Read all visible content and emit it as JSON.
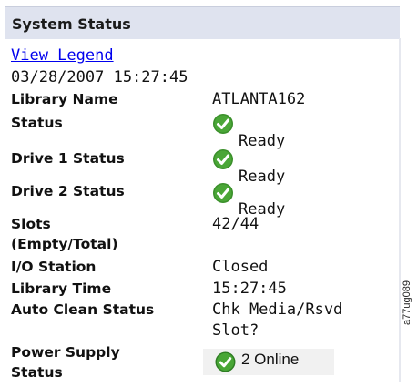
{
  "panel": {
    "title": "System Status",
    "legend_link": "View Legend",
    "timestamp": "03/28/2007 15:27:45"
  },
  "rows": {
    "library_name": {
      "label": "Library Name",
      "value": "ATLANTA162"
    },
    "status": {
      "label": "Status",
      "icon": "ready-check-icon",
      "value": "Ready"
    },
    "drive1": {
      "label": "Drive 1 Status",
      "icon": "ready-check-icon",
      "value": "Ready"
    },
    "drive2": {
      "label": "Drive 2 Status",
      "icon": "ready-check-icon",
      "value": "Ready"
    },
    "slots": {
      "label_line1": "Slots",
      "label_line2": "(Empty/Total)",
      "value": "42/44"
    },
    "io_station": {
      "label": "I/O Station",
      "value": "Closed"
    },
    "library_time": {
      "label": "Library Time",
      "value": "15:27:45"
    },
    "auto_clean": {
      "label": "Auto Clean Status",
      "value_line1": "Chk Media/Rsvd",
      "value_line2": "Slot?"
    },
    "power_supply": {
      "label_line1": "Power Supply",
      "label_line2": "Status",
      "icon": "ready-check-icon",
      "value": "2 Online"
    }
  },
  "figure_code": "a77ug089",
  "colors": {
    "header_bg": "#dfe3ef",
    "link": "#0000ee",
    "check_green": "#3a8f2a"
  }
}
